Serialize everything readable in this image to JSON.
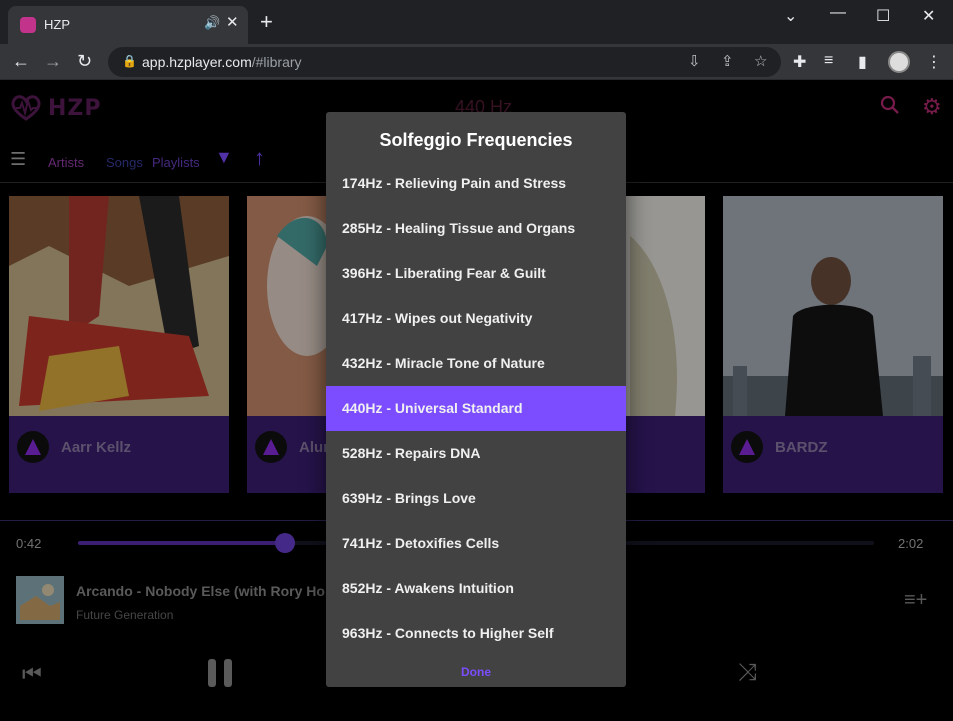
{
  "browser": {
    "tab_title": "HZP",
    "url_host": "app.hzplayer.com",
    "url_path": "/#library"
  },
  "app": {
    "logo_text": "HZP",
    "current_frequency": "440 Hz",
    "nav": {
      "artists": "Artists",
      "songs": "Songs",
      "playlists": "Playlists"
    },
    "cards": [
      {
        "name": "Aarr Kellz"
      },
      {
        "name": "Alur"
      },
      {
        "name": ""
      },
      {
        "name": "BARDZ"
      }
    ]
  },
  "player": {
    "elapsed": "0:42",
    "duration": "2:02",
    "progress": 0.26,
    "track_title": "Arcando - Nobody Else (with Rory Ho",
    "track_artist": "Future Generation"
  },
  "dialog": {
    "title": "Solfeggio Frequencies",
    "items": [
      "174Hz - Relieving Pain and Stress",
      "285Hz - Healing Tissue and Organs",
      "396Hz - Liberating Fear & Guilt",
      "417Hz - Wipes out Negativity",
      "432Hz - Miracle Tone of Nature",
      "440Hz - Universal Standard",
      "528Hz - Repairs DNA",
      "639Hz - Brings Love",
      "741Hz - Detoxifies Cells",
      "852Hz - Awakens Intuition",
      "963Hz - Connects to Higher Self"
    ],
    "selected_index": 5,
    "done_label": "Done"
  },
  "colors": {
    "accent": "#7c4dff",
    "brand": "#b52a72",
    "card_bg": "#3a1e72"
  }
}
